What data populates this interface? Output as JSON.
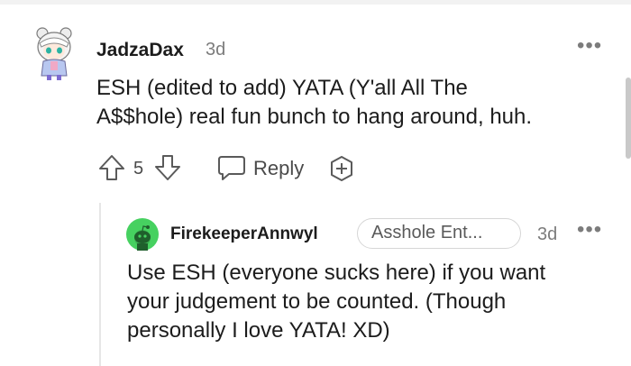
{
  "comments": [
    {
      "username": "JadzaDax",
      "time": "3d",
      "avatar_icon": "anime-character-avatar-icon",
      "body_lines": [
        "ESH (edited to add) YATA (Y'all All The",
        "A$$hole) real fun bunch to hang around, huh."
      ],
      "vote_count": "5",
      "reply_label": "Reply",
      "more_label": "•••"
    },
    {
      "username": "FirekeeperAnnwyl",
      "time": "3d",
      "avatar_icon": "green-snoo-avatar-icon",
      "flair": "Asshole Ent...",
      "body_lines": [
        "Use ESH (everyone sucks here) if you want",
        "your judgement to be counted. (Though",
        "personally I love YATA! XD)"
      ],
      "more_label": "•••"
    }
  ],
  "colors": {
    "text": "#1c1c1c",
    "muted": "#7c7c7c",
    "snoo_green": "#46d160",
    "divider": "#e6e6e6"
  }
}
